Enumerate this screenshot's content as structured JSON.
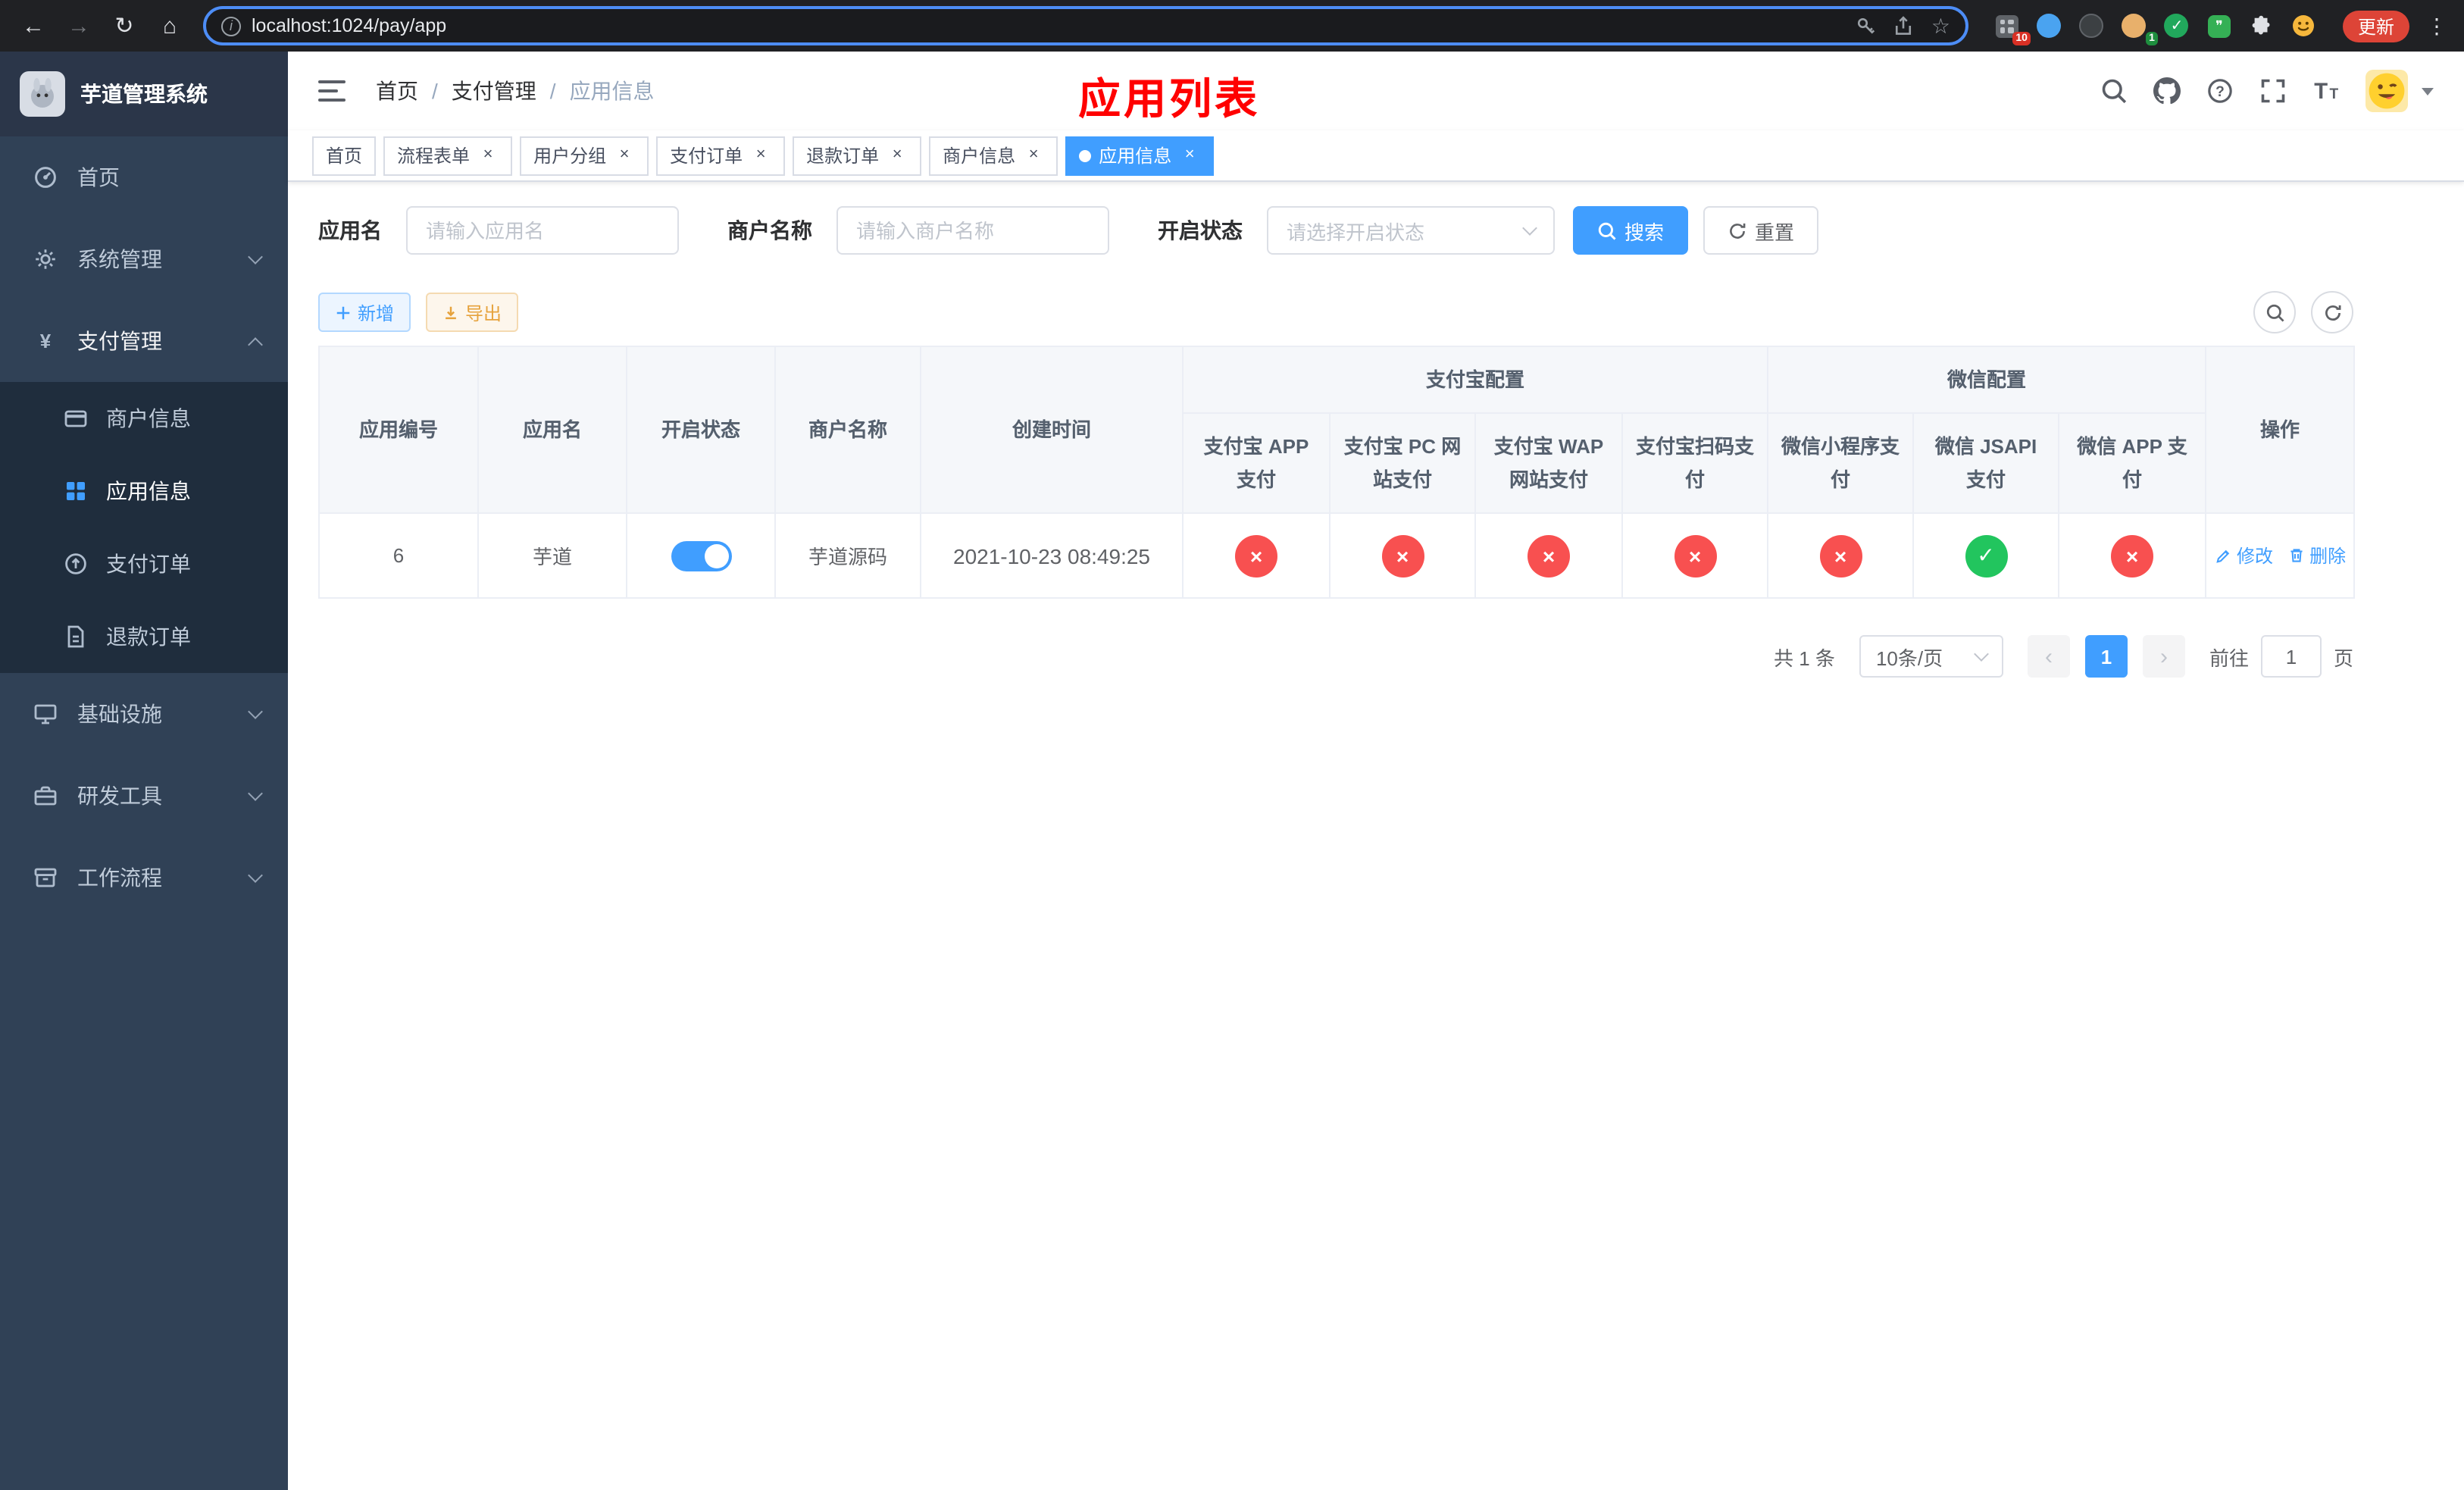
{
  "browser": {
    "url": "localhost:1024/pay/app",
    "update_label": "更新",
    "badge_grid": "10",
    "badge_avatar": "1"
  },
  "sidebar": {
    "app_title": "芋道管理系统",
    "items": [
      {
        "label": "首页"
      },
      {
        "label": "系统管理"
      },
      {
        "label": "支付管理"
      },
      {
        "label": "基础设施"
      },
      {
        "label": "研发工具"
      },
      {
        "label": "工作流程"
      }
    ],
    "payment_children": [
      {
        "label": "商户信息"
      },
      {
        "label": "应用信息"
      },
      {
        "label": "支付订单"
      },
      {
        "label": "退款订单"
      }
    ]
  },
  "header": {
    "breadcrumb": [
      "首页",
      "支付管理",
      "应用信息"
    ],
    "page_title": "应用列表"
  },
  "tabs": [
    {
      "label": "首页",
      "closable": false,
      "active": false
    },
    {
      "label": "流程表单",
      "closable": true,
      "active": false
    },
    {
      "label": "用户分组",
      "closable": true,
      "active": false
    },
    {
      "label": "支付订单",
      "closable": true,
      "active": false
    },
    {
      "label": "退款订单",
      "closable": true,
      "active": false
    },
    {
      "label": "商户信息",
      "closable": true,
      "active": false
    },
    {
      "label": "应用信息",
      "closable": true,
      "active": true
    }
  ],
  "filters": {
    "app_name_label": "应用名",
    "app_name_placeholder": "请输入应用名",
    "merchant_label": "商户名称",
    "merchant_placeholder": "请输入商户名称",
    "status_label": "开启状态",
    "status_placeholder": "请选择开启状态",
    "search_label": "搜索",
    "reset_label": "重置"
  },
  "toolbar": {
    "add_label": "新增",
    "export_label": "导出"
  },
  "table": {
    "col_app_id": "应用编号",
    "col_app_name": "应用名",
    "col_status": "开启状态",
    "col_merchant": "商户名称",
    "col_created": "创建时间",
    "col_actions": "操作",
    "group_alipay": "支付宝配置",
    "group_wechat": "微信配置",
    "sub_alipay_app": "支付宝 APP 支付",
    "sub_alipay_pc": "支付宝 PC 网站支付",
    "sub_alipay_wap": "支付宝 WAP 网站支付",
    "sub_alipay_scan": "支付宝扫码支付",
    "sub_wechat_mini": "微信小程序支付",
    "sub_wechat_jsapi": "微信 JSAPI 支付",
    "sub_wechat_app": "微信 APP 支付",
    "rows": [
      {
        "id": "6",
        "name": "芋道",
        "enabled": true,
        "merchant": "芋道源码",
        "created": "2021-10-23 08:49:25",
        "alipay_app": false,
        "alipay_pc": false,
        "alipay_wap": false,
        "alipay_scan": false,
        "wechat_mini": false,
        "wechat_jsapi": true,
        "wechat_app": false
      }
    ],
    "edit_label": "修改",
    "delete_label": "删除"
  },
  "pagination": {
    "total": "共 1 条",
    "page_size": "10条/页",
    "page": "1",
    "goto_prefix": "前往",
    "goto_value": "1",
    "goto_suffix": "页"
  },
  "icons": {
    "back": "arrow-left",
    "forward": "arrow-right",
    "reload": "circular-arrow",
    "home": "house",
    "site-info": "circled-i",
    "key": "key",
    "share": "box-arrow-up",
    "bookmark": "star",
    "menu": "three-dots",
    "hamburger": "three-bars",
    "search": "magnifier",
    "github": "octocat",
    "help": "question-circle",
    "fullscreen": "corner-brackets",
    "font-size": "double-T",
    "dashboard": "gauge",
    "system": "gear",
    "payment": "yen-sign",
    "merchant": "bank-card",
    "app-info": "grid",
    "pay-order": "circle-arrow-up",
    "refund": "document",
    "infra": "monitor",
    "devtools": "toolbox",
    "workflow": "archive-box",
    "enabled-true": "check-circle",
    "enabled-false": "cross-circle",
    "edit": "pencil",
    "delete": "trash"
  },
  "colors": {
    "primary": "#409eff",
    "danger": "#f85050",
    "success": "#22c55e",
    "warning": "#e6a23c",
    "title_red": "#ff0000",
    "sidebar_bg": "#304156",
    "submenu_bg": "#1f2d3d",
    "browser_bar_bg": "#202124"
  }
}
